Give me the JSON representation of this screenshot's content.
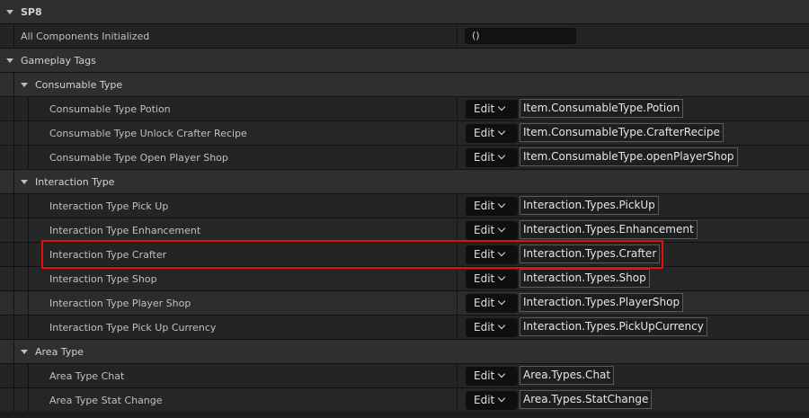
{
  "sections": {
    "sp8": {
      "label": "SP8"
    },
    "all_components": {
      "label": "All Components Initialized",
      "value": "()"
    },
    "gameplay_tags": {
      "label": "Gameplay Tags"
    },
    "consumable_type": {
      "label": "Consumable Type",
      "items": [
        {
          "label": "Consumable Type Potion",
          "edit": "Edit",
          "tag": "Item.ConsumableType.Potion"
        },
        {
          "label": "Consumable Type Unlock Crafter Recipe",
          "edit": "Edit",
          "tag": "Item.ConsumableType.CrafterRecipe"
        },
        {
          "label": "Consumable Type Open Player Shop",
          "edit": "Edit",
          "tag": "Item.ConsumableType.openPlayerShop"
        }
      ]
    },
    "interaction_type": {
      "label": "Interaction Type",
      "items": [
        {
          "label": "Interaction Type Pick Up",
          "edit": "Edit",
          "tag": "Interaction.Types.PickUp"
        },
        {
          "label": "Interaction Type Enhancement",
          "edit": "Edit",
          "tag": "Interaction.Types.Enhancement"
        },
        {
          "label": "Interaction Type Crafter",
          "edit": "Edit",
          "tag": "Interaction.Types.Crafter"
        },
        {
          "label": "Interaction Type Shop",
          "edit": "Edit",
          "tag": "Interaction.Types.Shop"
        },
        {
          "label": "Interaction Type Player Shop",
          "edit": "Edit",
          "tag": "Interaction.Types.PlayerShop"
        },
        {
          "label": "Interaction Type Pick Up Currency",
          "edit": "Edit",
          "tag": "Interaction.Types.PickUpCurrency"
        }
      ]
    },
    "area_type": {
      "label": "Area Type",
      "items": [
        {
          "label": "Area Type Chat",
          "edit": "Edit",
          "tag": "Area.Types.Chat"
        },
        {
          "label": "Area Type Stat Change",
          "edit": "Edit",
          "tag": "Area.Types.StatChange"
        }
      ]
    }
  },
  "highlight_color": "#e01010"
}
